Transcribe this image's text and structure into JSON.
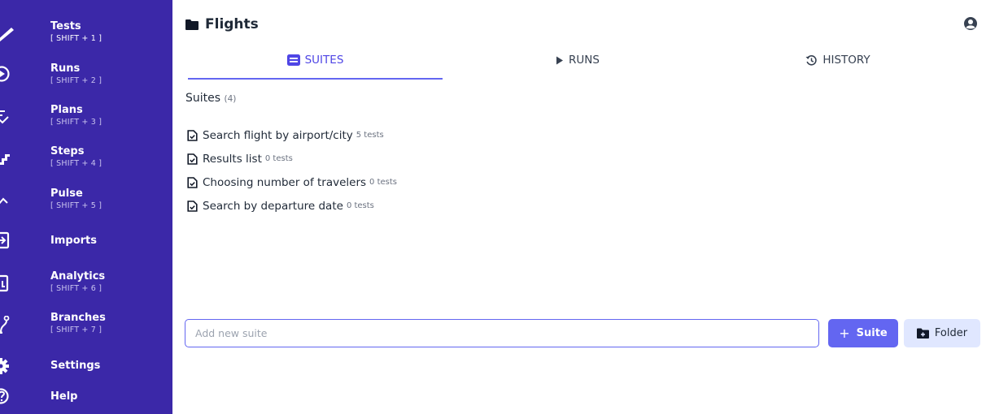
{
  "sidebar": {
    "items": [
      {
        "label": "Tests",
        "shortcut": "[ SHIFT + 1 ]",
        "icon": "pencil-icon"
      },
      {
        "label": "Runs",
        "shortcut": "[ SHIFT + 2 ]",
        "icon": "play-circle-icon"
      },
      {
        "label": "Plans",
        "shortcut": "[ SHIFT + 3 ]",
        "icon": "checklist-icon"
      },
      {
        "label": "Steps",
        "shortcut": "[ SHIFT + 4 ]",
        "icon": "stairs-icon"
      },
      {
        "label": "Pulse",
        "shortcut": "[ SHIFT + 5 ]",
        "icon": "pulse-icon"
      },
      {
        "label": "Imports",
        "icon": "import-icon"
      },
      {
        "label": "Analytics",
        "shortcut": "[ SHIFT + 6 ]",
        "icon": "analytics-icon"
      },
      {
        "label": "Branches",
        "shortcut": "[ SHIFT + 7 ]",
        "icon": "branch-icon"
      },
      {
        "label": "Settings",
        "icon": "gear-icon"
      },
      {
        "label": "Help",
        "icon": "help-icon"
      }
    ]
  },
  "header": {
    "title": "Flights",
    "title_icon": "folder-icon",
    "user_icon": "user-circle-icon"
  },
  "tabs": [
    {
      "label": "SUITES",
      "icon": "list-icon",
      "active": true
    },
    {
      "label": "RUNS",
      "icon": "play-icon",
      "active": false
    },
    {
      "label": "HISTORY",
      "icon": "history-icon",
      "active": false
    }
  ],
  "suites": {
    "heading": "Suites",
    "count": "(4)",
    "items": [
      {
        "name": "Search flight by airport/city",
        "tests": "5 tests"
      },
      {
        "name": "Results list",
        "tests": "0 tests"
      },
      {
        "name": "Choosing number of travelers",
        "tests": "0 tests"
      },
      {
        "name": "Search by departure date",
        "tests": "0 tests"
      }
    ]
  },
  "new_suite": {
    "placeholder": "Add new suite",
    "add_suite_label": "Suite",
    "add_suite_plus": "+",
    "add_folder_label": "Folder"
  },
  "colors": {
    "sidebar": "#3b28a8",
    "accent": "#6366f1",
    "accent_light": "#e0e7ff"
  }
}
